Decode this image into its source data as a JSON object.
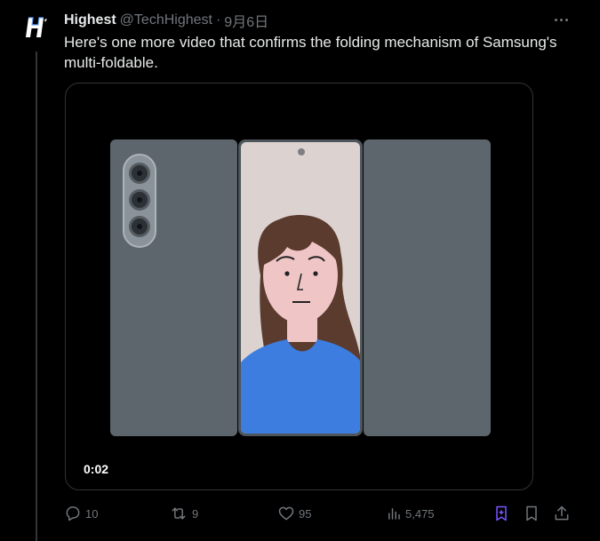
{
  "tweet": {
    "author_name": "Highest",
    "author_handle": "@TechHighest",
    "separator": "·",
    "date": "9月6日",
    "text": "Here's one more video that confirms the folding mechanism of Samsung's multi-foldable.",
    "avatar_letter": "H"
  },
  "media": {
    "video_timestamp": "0:02"
  },
  "actions": {
    "replies": "10",
    "reposts": "9",
    "likes": "95",
    "views": "5,475"
  },
  "colors": {
    "background": "#000000",
    "text_primary": "#e7e9ea",
    "text_secondary": "#71767b",
    "panel_gray": "#5c666c",
    "shirt_blue": "#3d7de0",
    "grok_purple": "#7856ff"
  },
  "icons": [
    "more-icon",
    "reply-icon",
    "repost-icon",
    "like-icon",
    "views-icon",
    "grok-icon",
    "bookmark-icon",
    "share-icon"
  ]
}
